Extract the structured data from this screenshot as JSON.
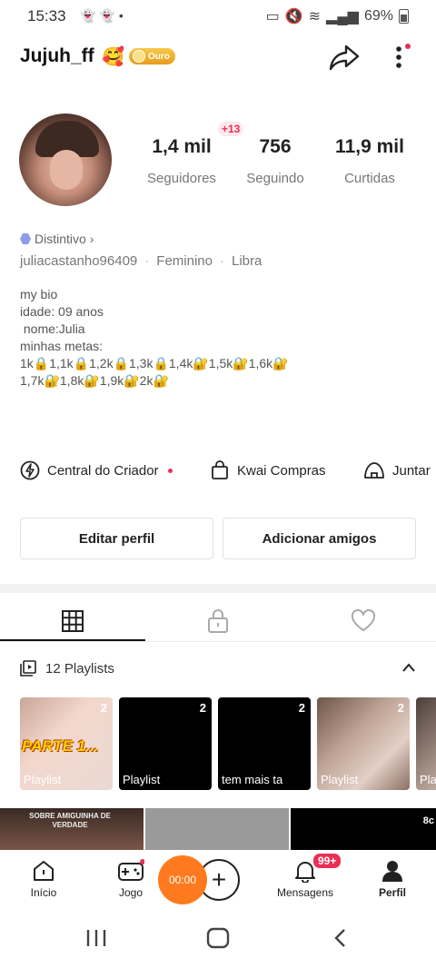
{
  "status_bar": {
    "time": "15:33",
    "battery": "69%"
  },
  "profile": {
    "username": "Jujuh_ff",
    "name_emoji": "🥰",
    "badge_label": "Ouro",
    "followers_delta": "+13",
    "stats": [
      {
        "value": "1,4 mil",
        "label": "Seguidores"
      },
      {
        "value": "756",
        "label": "Seguindo"
      },
      {
        "value": "11,9 mil",
        "label": "Curtidas"
      }
    ],
    "distintivo": "Distintivo",
    "handle": "juliacastanho96409",
    "gender": "Feminino",
    "sign": "Libra",
    "bio_lines": [
      "my bio",
      "",
      "idade: 09 anos",
      " nome:Julia",
      "",
      "",
      "minhas metas:",
      "1k🔒1,1k🔒1,2k🔒1,3k🔒1,4k🔐1,5k🔐1,6k🔐",
      "1,7k🔐1,8k🔐1,9k🔐2k🔐"
    ]
  },
  "actions": [
    {
      "label": "Central do Criador",
      "icon": "lightning-icon"
    },
    {
      "label": "Kwai Compras",
      "icon": "shopping-bag-icon"
    },
    {
      "label": "Juntar",
      "icon": "tent-icon"
    }
  ],
  "buttons": {
    "edit": "Editar perfil",
    "add_friends": "Adicionar amigos"
  },
  "playlists": {
    "header": "12 Playlists",
    "cards": [
      {
        "count": "2",
        "caption": "Playlist",
        "overlay": "PARTE 1..."
      },
      {
        "count": "2",
        "caption": "Playlist"
      },
      {
        "count": "2",
        "caption": "tem mais ta"
      },
      {
        "count": "2",
        "caption": "Playlist"
      },
      {
        "count": "",
        "caption": "Pla"
      }
    ]
  },
  "grid_strip": {
    "text_left": "SOBRE AMIGUINHA DE VERDADE",
    "text_right": "8c"
  },
  "bottom_nav": {
    "items": [
      "Início",
      "Jogo",
      "Mensagens",
      "Perfil"
    ],
    "timer": "00:00",
    "messages_badge": "99+"
  },
  "colors": {
    "accent": "#ff7a1e",
    "badge_red": "#ea2f55",
    "gold": "#f0b03a"
  }
}
